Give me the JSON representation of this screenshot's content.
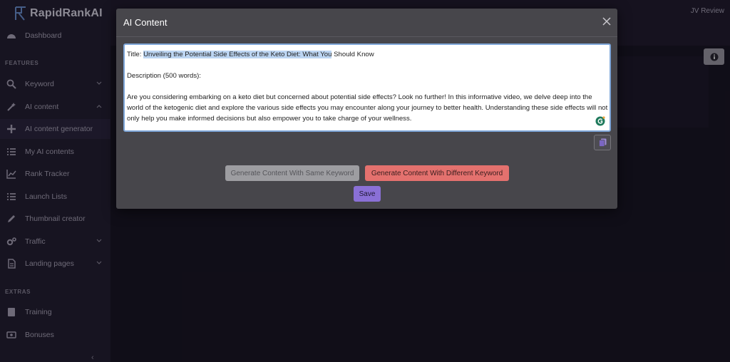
{
  "app": {
    "logo_text": "RapidRankAI",
    "top_right_link": "JV Review"
  },
  "sidebar": {
    "sections": {
      "features": "FEATURES",
      "extras": "EXTRAS"
    },
    "items": [
      {
        "label": "Dashboard",
        "icon": "dashboard-icon"
      },
      {
        "label": "Keyword",
        "icon": "search-icon"
      },
      {
        "label": "AI content",
        "icon": "wand-icon"
      },
      {
        "label": "AI content generator",
        "icon": "plus-icon"
      },
      {
        "label": "My AI contents",
        "icon": "list-icon"
      },
      {
        "label": "Rank Tracker",
        "icon": "chart-icon"
      },
      {
        "label": "Launch Lists",
        "icon": "list-icon"
      },
      {
        "label": "Thumbnail creator",
        "icon": "pencil-icon"
      },
      {
        "label": "Traffic",
        "icon": "gears-icon"
      },
      {
        "label": "Landing pages",
        "icon": "file-icon"
      },
      {
        "label": "Training",
        "icon": "book-icon"
      },
      {
        "label": "Bonuses",
        "icon": "money-icon"
      }
    ],
    "collapse_glyph": "‹"
  },
  "modal": {
    "title": "AI Content",
    "content": {
      "title_prefix": "Title: ",
      "title_highlighted": "Unveiling the Potential Side Effects of the Keto Diet: What You",
      "title_rest": " Should Know",
      "description_label": "Description (500 words):",
      "body": "Are you considering embarking on a keto diet but concerned about potential side effects? Look no further! In this informative video, we delve deep into the world of the ketogenic diet and explore the various side effects you may encounter along your journey to better health. Understanding these side effects will not only help you make informed decisions but also empower you to take charge of your wellness."
    },
    "buttons": {
      "same_keyword": "Generate Content With Same Keyword",
      "different_keyword": "Generate Content With Different Keyword",
      "save": "Save"
    }
  },
  "colors": {
    "modal_bg": "#47464b",
    "highlight": "#bcd5f2",
    "danger_button": "#e4716e",
    "save_button": "#8a70d6",
    "textarea_border": "#7ea6d8"
  }
}
